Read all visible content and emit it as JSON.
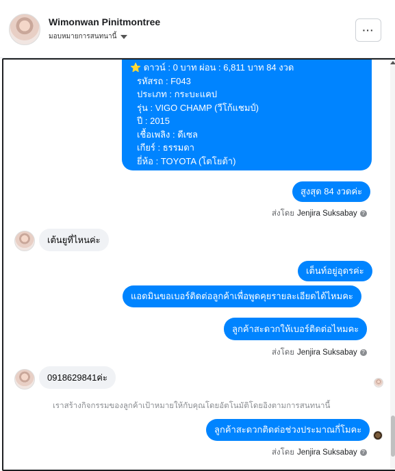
{
  "header": {
    "name": "Wimonwan Pinitmontree",
    "subtitle": "มอบหมายการสนทนานี้",
    "more_label": "···"
  },
  "messages": {
    "detail_lines": [
      "⭐ ดาวน์ : 0 บาท ผ่อน : 6,811 บาท 84 งวด",
      "รหัสรถ : F043",
      "ประเภท : กระบะแคป",
      "รุ่น : VIGO CHAMP (วีโก้แชมป์)",
      "ปี : 2015",
      "เชื้อเพลิง : ดีเซล",
      "เกียร์ : ธรรมดา",
      "ยี่ห้อ : TOYOTA (โตโยต้า)"
    ],
    "m1": "สูงสุด 84 งวดค่ะ",
    "m2": "เต้นยูที่ไหนค่ะ",
    "m3": "เต็นท์อยู่อุดรค่ะ",
    "m4": "แอดมินขอเบอร์ติดต่อลูกค้าเพื่อพูดคุยรายละเอียดได้ไหมคะ",
    "m5": "ลูกค้าสะดวกให้เบอร์ติดต่อไหมคะ",
    "m6": "0918629841ค่ะ",
    "m7": "ลูกค้าสะดวกติดต่อช่วงประมาณกี่โมคะ"
  },
  "sent_by": {
    "prefix": "ส่งโดย",
    "agent": "Jenjira Suksabay"
  },
  "info": "เราสร้างกิจกรรมของลูกค้าเป้าหมายให้กับคุณโดยอัตโนมัติโดยอิงตามการสนทนานี้"
}
